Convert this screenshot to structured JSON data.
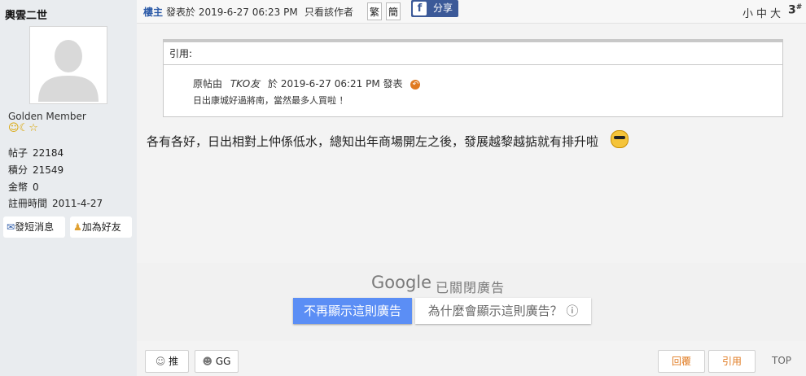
{
  "sidebar": {
    "username": "輿雲二世",
    "member_title": "Golden Member",
    "rank_icons": "☺☾☆",
    "stats": [
      {
        "label": "帖子",
        "value": "22184"
      },
      {
        "label": "積分",
        "value": "21549"
      },
      {
        "label": "金幣",
        "value": "0"
      },
      {
        "label": "註冊時間",
        "value": "2011-4-27"
      }
    ],
    "pm_button": "發短消息",
    "add_friend_button": "加為好友"
  },
  "topbar": {
    "author_tag": "樓主",
    "posted_at": "發表於  2019-6-27 06:23 PM",
    "only_author": "只看該作者",
    "trad_btn": "繁",
    "simp_btn": "簡",
    "fb_icon": "f",
    "share_label": "分享",
    "font_sizes": "小中大",
    "floor_num": "3",
    "floor_sup": "#"
  },
  "quote": {
    "header": "引用:",
    "orig_prefix": "原帖由",
    "orig_author": "TKO友",
    "orig_mid": "於  2019-6-27  06:21  PM  發表",
    "orig_text": "日出康城好過將南，當然最多人買啦 ！"
  },
  "post": {
    "message": "各有各好，日出相對上仲係低水，總知出年商場開左之後，發展越黎越掂就有排升啦"
  },
  "ad": {
    "google": "Google",
    "closed": "已關閉廣告",
    "stop_button": "不再顯示這則廣告",
    "why_button": "為什麼會顯示這則廣告？ ⓘ"
  },
  "actions": {
    "push": "推",
    "gg": "GG",
    "reply": "回覆",
    "quote": "引用",
    "top": "TOP"
  },
  "colors": {
    "link_blue": "#2b5aa8",
    "accent_orange": "#e07b22",
    "facebook": "#3b5998",
    "ad_button": "#5b8ef5"
  }
}
